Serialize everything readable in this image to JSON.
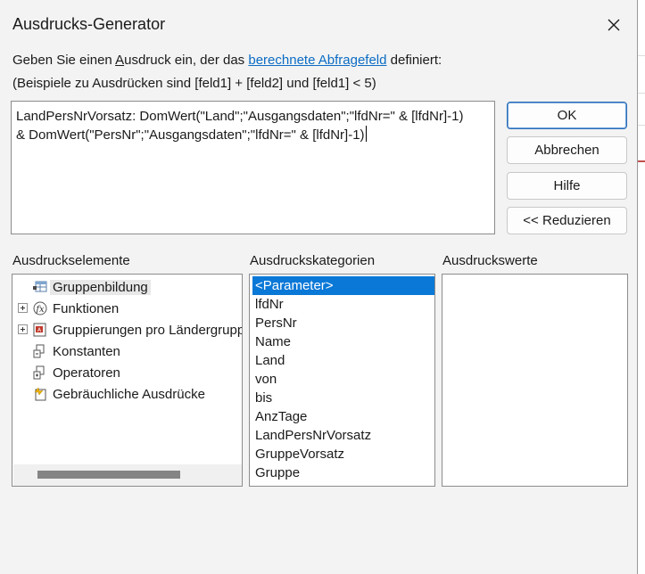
{
  "dialog": {
    "title": "Ausdrucks-Generator",
    "close_icon": "close-icon"
  },
  "description": {
    "part1": "Geben Sie einen ",
    "accel_letter": "A",
    "part2": "usdruck ein, der das ",
    "link_text": "berechnete Abfragefeld",
    "part3": " definiert:",
    "examples": "(Beispiele zu Ausdrücken sind [feld1] + [feld2] und [feld1] < 5)"
  },
  "expression": {
    "value": "LandPersNrVorsatz: DomWert(\"Land\";\"Ausgangsdaten\";\"lfdNr=\" & [lfdNr]-1)\n& DomWert(\"PersNr\";\"Ausgangsdaten\";\"lfdNr=\" & [lfdNr]-1)"
  },
  "buttons": {
    "ok": "OK",
    "cancel": "Abbrechen",
    "help": "Hilfe",
    "reduce": "<< Reduzieren"
  },
  "elements_panel": {
    "label": "Ausdruckselemente",
    "items": [
      {
        "label": "Gruppenbildung",
        "icon": "table-icon",
        "expandable": false,
        "selected": true
      },
      {
        "label": "Funktionen",
        "icon": "function-icon",
        "expandable": true,
        "selected": false
      },
      {
        "label": "Gruppierungen pro Ländergruppe",
        "icon": "query-icon",
        "expandable": true,
        "selected": false
      },
      {
        "label": "Konstanten",
        "icon": "constants-icon",
        "expandable": false,
        "selected": false
      },
      {
        "label": "Operatoren",
        "icon": "operators-icon",
        "expandable": false,
        "selected": false
      },
      {
        "label": "Gebräuchliche Ausdrücke",
        "icon": "common-expressions-icon",
        "expandable": false,
        "selected": false
      }
    ]
  },
  "categories_panel": {
    "label": "Ausdruckskategorien",
    "items": [
      "<Parameter>",
      "lfdNr",
      "PersNr",
      "Name",
      "Land",
      "von",
      "bis",
      "AnzTage",
      "LandPersNrVorsatz",
      "GruppeVorsatz",
      "Gruppe"
    ],
    "selected_index": 0
  },
  "values_panel": {
    "label": "Ausdruckswerte",
    "items": []
  },
  "colors": {
    "accent": "#0a78d7",
    "link": "#0b6cc4",
    "dialog_bg": "#f3f3f3"
  }
}
